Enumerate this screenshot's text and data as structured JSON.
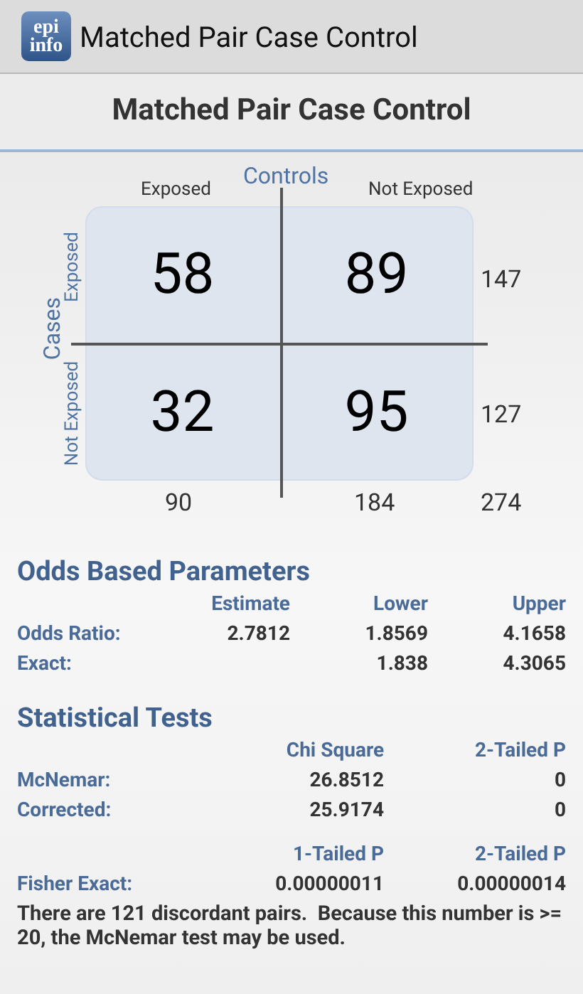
{
  "app_bar": {
    "logo_lines": [
      "epi",
      "info"
    ],
    "title": "Matched Pair Case Control"
  },
  "heading": "Matched Pair Case Control",
  "table": {
    "controls_label": "Controls",
    "cases_label": "Cases",
    "column_labels": [
      "Exposed",
      "Not Exposed"
    ],
    "row_labels": [
      "Exposed",
      "Not Exposed"
    ],
    "rows": [
      {
        "cells": [
          "58",
          "89"
        ],
        "total": "147"
      },
      {
        "cells": [
          "32",
          "95"
        ],
        "total": "127"
      }
    ],
    "column_totals": [
      "90",
      "184"
    ],
    "grand_total": "274"
  },
  "odds": {
    "title": "Odds Based Parameters",
    "columns": [
      "Estimate",
      "Lower",
      "Upper"
    ],
    "rows": [
      {
        "label": "Odds Ratio:",
        "estimate": "2.7812",
        "lower": "1.8569",
        "upper": "4.1658"
      },
      {
        "label": "Exact:",
        "lower": "1.838",
        "upper": "4.3065"
      }
    ]
  },
  "tests": {
    "title": "Statistical Tests",
    "groups": [
      {
        "columns": [
          "Chi Square",
          "2-Tailed P"
        ],
        "rows": [
          {
            "label": "McNemar:",
            "values": [
              "26.8512",
              "0"
            ]
          },
          {
            "label": "Corrected:",
            "values": [
              "25.9174",
              "0"
            ]
          }
        ]
      },
      {
        "columns": [
          "1-Tailed P",
          "2-Tailed P"
        ],
        "rows": [
          {
            "label": "Fisher Exact:",
            "values": [
              "0.00000011",
              "0.00000014"
            ]
          }
        ]
      }
    ]
  },
  "note": "There are 121 discordant pairs.  Because this number is >= 20, the McNemar test may be used."
}
